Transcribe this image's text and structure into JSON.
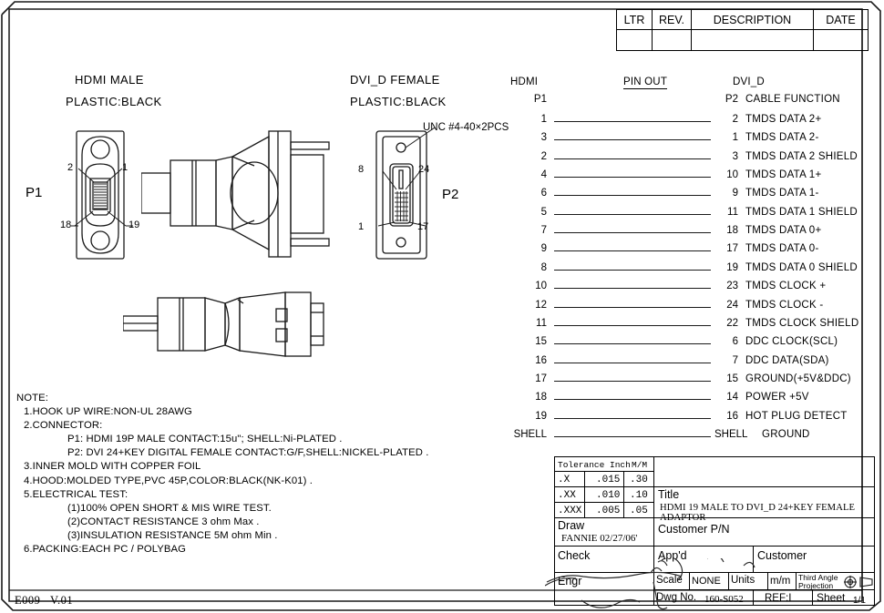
{
  "sheet": {
    "footer_left": "E009   V.01"
  },
  "revision_table": {
    "headers": [
      "LTR",
      "REV.",
      "DESCRIPTION",
      "DATE"
    ],
    "rows": [
      [
        "",
        "",
        "",
        ""
      ]
    ]
  },
  "connectors": {
    "p1": {
      "title": "HDMI MALE",
      "subtitle": "PLASTIC:BLACK",
      "ref": "P1",
      "pin_callouts": [
        "2",
        "1",
        "18",
        "19"
      ]
    },
    "p2": {
      "title": "DVI_D FEMALE",
      "subtitle": "PLASTIC:BLACK",
      "ref": "P2",
      "screw_note": "UNC #4-40×2PCS",
      "pin_callouts": [
        "8",
        "24",
        "1",
        "17"
      ]
    }
  },
  "pinout": {
    "heading_left": "HDMI",
    "heading_center": "PIN OUT",
    "heading_right": "DVI_D",
    "col_left_label": "P1",
    "col_right_label": "P2",
    "col_function_label": "CABLE FUNCTION",
    "rows": [
      {
        "hdmi": "1",
        "dvi": "2",
        "function": "TMDS DATA 2+"
      },
      {
        "hdmi": "3",
        "dvi": "1",
        "function": "TMDS DATA 2-"
      },
      {
        "hdmi": "2",
        "dvi": "3",
        "function": "TMDS DATA 2 SHIELD"
      },
      {
        "hdmi": "4",
        "dvi": "10",
        "function": "TMDS DATA 1+"
      },
      {
        "hdmi": "6",
        "dvi": "9",
        "function": "TMDS DATA 1-"
      },
      {
        "hdmi": "5",
        "dvi": "11",
        "function": "TMDS DATA 1 SHIELD"
      },
      {
        "hdmi": "7",
        "dvi": "18",
        "function": "TMDS DATA 0+"
      },
      {
        "hdmi": "9",
        "dvi": "17",
        "function": "TMDS DATA 0-"
      },
      {
        "hdmi": "8",
        "dvi": "19",
        "function": "TMDS DATA 0 SHIELD"
      },
      {
        "hdmi": "10",
        "dvi": "23",
        "function": "TMDS CLOCK +"
      },
      {
        "hdmi": "12",
        "dvi": "24",
        "function": "TMDS CLOCK -"
      },
      {
        "hdmi": "11",
        "dvi": "22",
        "function": "TMDS CLOCK SHIELD"
      },
      {
        "hdmi": "15",
        "dvi": "6",
        "function": "DDC CLOCK(SCL)"
      },
      {
        "hdmi": "16",
        "dvi": "7",
        "function": "DDC DATA(SDA)"
      },
      {
        "hdmi": "17",
        "dvi": "15",
        "function": "GROUND(+5V&DDC)"
      },
      {
        "hdmi": "18",
        "dvi": "14",
        "function": "POWER +5V"
      },
      {
        "hdmi": "19",
        "dvi": "16",
        "function": "HOT PLUG DETECT"
      },
      {
        "hdmi": "SHELL",
        "dvi": "SHELL",
        "function": "GROUND"
      }
    ]
  },
  "notes": {
    "heading": "NOTE:",
    "lines": [
      {
        "indent": 1,
        "text": "1.HOOK UP WIRE:NON-UL 28AWG"
      },
      {
        "indent": 1,
        "text": "2.CONNECTOR:"
      },
      {
        "indent": 2,
        "text": "P1: HDMI 19P MALE CONTACT:15u\"; SHELL:Ni-PLATED ."
      },
      {
        "indent": 2,
        "text": "P2: DVI 24+KEY DIGITAL FEMALE CONTACT:G/F,SHELL:NICKEL-PLATED ."
      },
      {
        "indent": 1,
        "text": "3.INNER MOLD WITH COPPER FOIL"
      },
      {
        "indent": 1,
        "text": "4.HOOD:MOLDED TYPE,PVC 45P,COLOR:BLACK(NK-K01) ."
      },
      {
        "indent": 1,
        "text": "5.ELECTRICAL TEST:"
      },
      {
        "indent": 2,
        "text": "(1)100% OPEN SHORT & MIS WIRE TEST."
      },
      {
        "indent": 2,
        "text": "(2)CONTACT RESISTANCE 3 ohm Max ."
      },
      {
        "indent": 2,
        "text": "(3)INSULATION RESISTANCE 5M ohm Min ."
      },
      {
        "indent": 1,
        "text": "6.PACKING:EACH PC / POLYBAG"
      }
    ]
  },
  "title_block": {
    "tolerance": {
      "header": [
        "Tolerance Inch",
        "M/M"
      ],
      "rows": [
        {
          "place": ".X",
          "inch": ".015",
          "mm": ".30"
        },
        {
          "place": ".XX",
          "inch": ".010",
          "mm": ".10"
        },
        {
          "place": ".XXX",
          "inch": ".005",
          "mm": ".05"
        }
      ]
    },
    "draw_label": "Draw",
    "draw_value": "FANNIE 02/27/06'",
    "check_label": "Check",
    "engr_label": "Engr",
    "title_label": "Title",
    "title_value": "HDMI 19 MALE TO DVI_D 24+KEY FEMALE ADAPTOR",
    "customer_pn_label": "Customer P/N",
    "approved_label": "App'd",
    "customer_label": "Customer",
    "scale_label": "Scale",
    "scale_value": "NONE",
    "units_label": "Units",
    "units_value": "m/m",
    "projection_label_line1": "Third Angle",
    "projection_label_line2": "Projection",
    "dwg_no_label": "Dwg No.",
    "dwg_no_value": "160-S052",
    "ref_label": "REF:I",
    "sheet_label": "Sheet",
    "sheet_value": "1/1"
  }
}
